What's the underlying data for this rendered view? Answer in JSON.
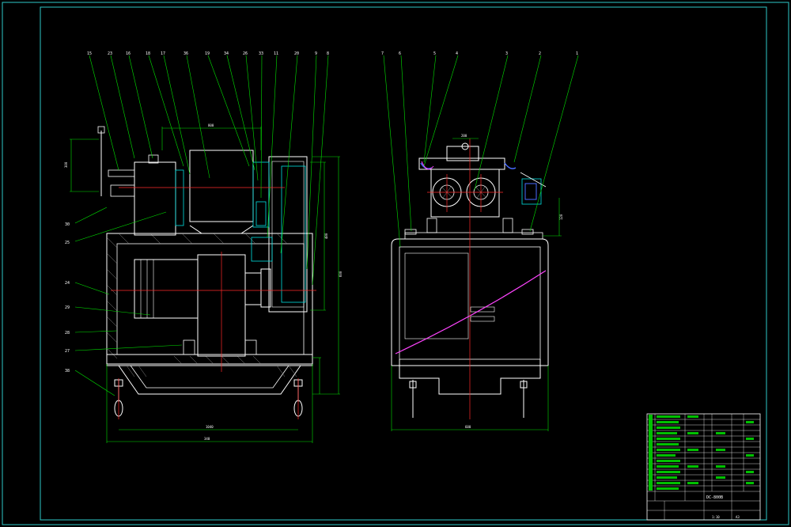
{
  "drawing": {
    "colors": {
      "background": "#000000",
      "frame": "#2ec8c8",
      "outline": "#ffffff",
      "leader": "#00e000",
      "center": "#ff2a2a",
      "hatch": "#8a8a8a",
      "accent_cyan": "#00e0e0",
      "accent_magenta": "#ff44ff",
      "accent_blue": "#4a6cff"
    },
    "front_view": {
      "balloons": [
        "15",
        "23",
        "16",
        "18",
        "17",
        "36",
        "19",
        "34",
        "26",
        "33",
        "11",
        "20",
        "9",
        "8"
      ],
      "side_balloons": [
        "30",
        "25",
        "24",
        "29",
        "28",
        "27",
        "38"
      ],
      "dimensions": [
        "300",
        "800",
        "480",
        "600",
        "1040",
        "340"
      ]
    },
    "side_view": {
      "balloons": [
        "7",
        "6",
        "5",
        "4",
        "3",
        "2",
        "1"
      ],
      "dimensions": [
        "200",
        "600",
        "120"
      ]
    },
    "title_block": {
      "title": "DC-800B",
      "sheet": "1:10",
      "scale_label": "A3"
    }
  }
}
